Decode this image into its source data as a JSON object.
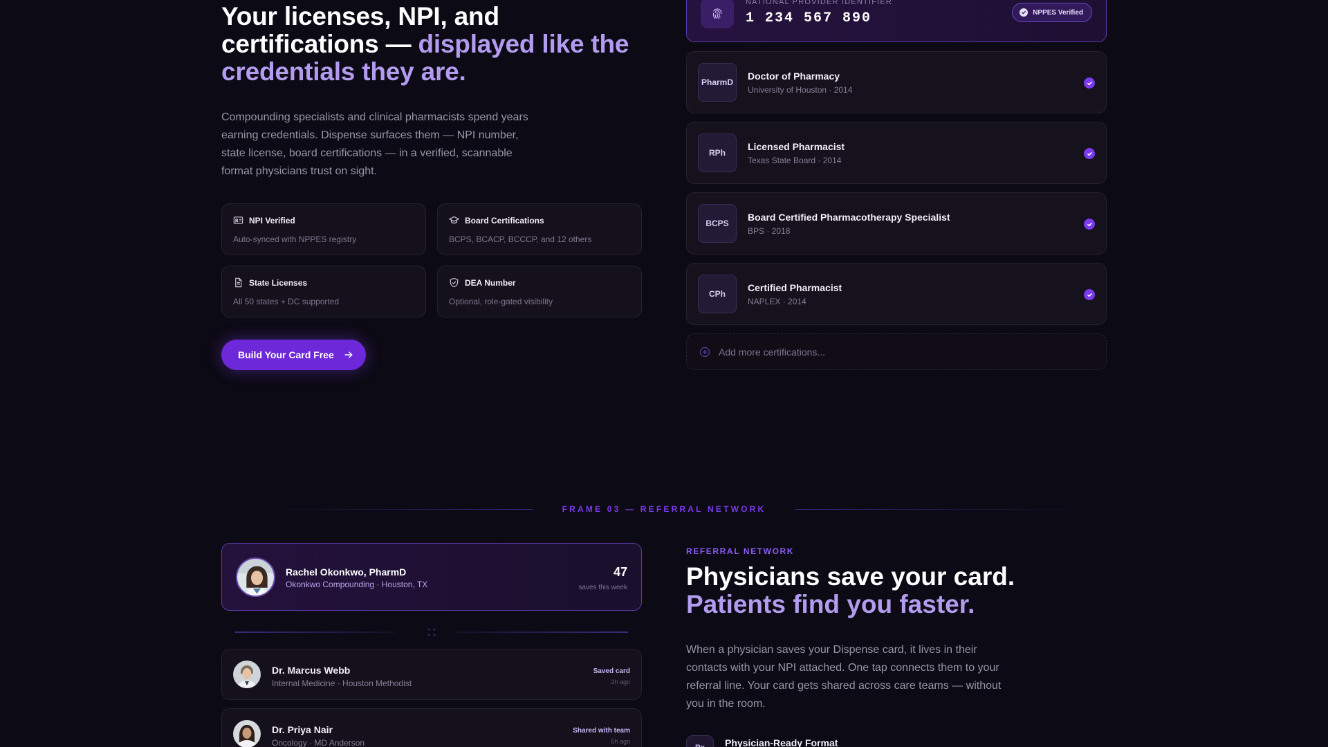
{
  "hero": {
    "title_line1": "Your licenses, NPI, and",
    "title_line2_plain": "certifications — ",
    "title_line2_accent": "displayed like the",
    "title_line3_accent": "credentials they are.",
    "description": "Compounding specialists and clinical pharmacists spend years earning credentials. Dispense surfaces them — NPI number, state license, board certifications — in a verified, scannable format physicians trust on sight."
  },
  "features": [
    {
      "icon": "id-card-icon",
      "title": "NPI Verified",
      "subtitle": "Auto-synced with NPPES registry"
    },
    {
      "icon": "graduation-cap-icon",
      "title": "Board Certifications",
      "subtitle": "BCPS, BCACP, BCCCP, and 12 others"
    },
    {
      "icon": "document-icon",
      "title": "State Licenses",
      "subtitle": "All 50 states + DC supported"
    },
    {
      "icon": "shield-check-icon",
      "title": "DEA Number",
      "subtitle": "Optional, role-gated visibility"
    }
  ],
  "cta": {
    "label": "Build Your Card Free",
    "icon": "arrow-right-icon"
  },
  "npi": {
    "label": "NATIONAL PROVIDER IDENTIFIER",
    "number": "1 234 567 890",
    "badge": "NPPES Verified",
    "icon": "fingerprint-icon"
  },
  "credentials": [
    {
      "abbr": "PharmD",
      "title": "Doctor of Pharmacy",
      "subtitle": "University of Houston · 2014"
    },
    {
      "abbr": "RPh",
      "title": "Licensed Pharmacist",
      "subtitle": "Texas State Board · 2014"
    },
    {
      "abbr": "BCPS",
      "title": "Board Certified Pharmacotherapy Specialist",
      "subtitle": "BPS · 2018"
    },
    {
      "abbr": "CPh",
      "title": "Certified Pharmacist",
      "subtitle": "NAPLEX · 2014"
    }
  ],
  "add_more": {
    "label": "Add more certifications...",
    "icon": "plus-circle-icon"
  },
  "frame": {
    "label": "FRAME 03 — REFERRAL NETWORK"
  },
  "profile": {
    "name": "Rachel Okonkwo, PharmD",
    "org": "Okonkwo Compounding · Houston, TX",
    "saves_count": "47",
    "saves_label": "saves this week"
  },
  "referrals": [
    {
      "name": "Dr. Marcus Webb",
      "subtitle": "Internal Medicine · Houston Methodist",
      "status": "Saved card",
      "time": "2h ago"
    },
    {
      "name": "Dr. Priya Nair",
      "subtitle": "Oncology · MD Anderson",
      "status": "Shared with team",
      "time": "5h ago"
    }
  ],
  "referral_section": {
    "eyebrow": "REFERRAL NETWORK",
    "title_plain": "Physicians save your card.",
    "title_accent": "Patients find you faster.",
    "description": "When a physician saves your Dispense card, it lives in their contacts with your NPI attached. One tap connects them to your referral line. Your card gets shared across care teams — without you in the room.",
    "feature_badge": "Rx",
    "feature_title": "Physician-Ready Format"
  },
  "colors": {
    "accent": "#7c3aed",
    "accent_light": "#b39cf0",
    "background": "#0c0a14"
  }
}
